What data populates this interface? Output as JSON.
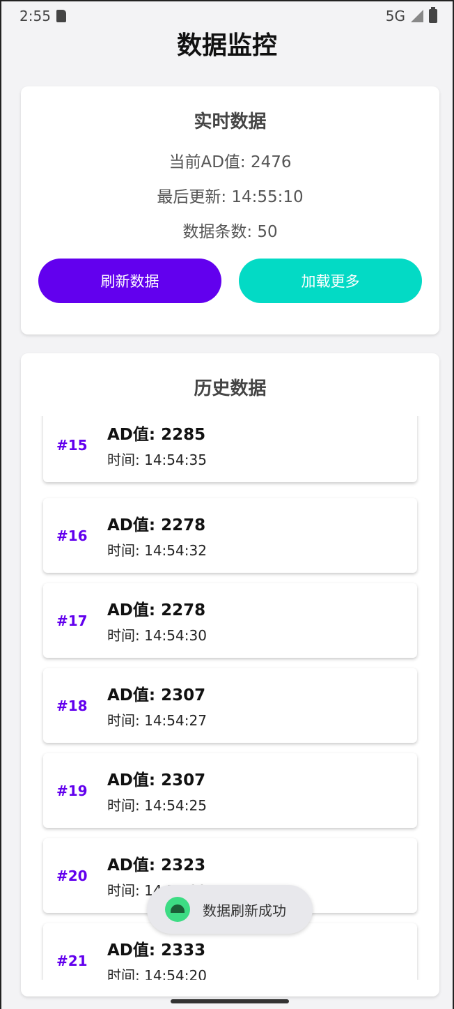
{
  "status_bar": {
    "time": "2:55",
    "network": "5G",
    "icons": [
      "sd-card-icon",
      "signal-icon",
      "battery-icon"
    ]
  },
  "page": {
    "title": "数据监控"
  },
  "realtime": {
    "title": "实时数据",
    "current_ad": "当前AD值: 2476",
    "last_update": "最后更新: 14:55:10",
    "count": "数据条数: 50",
    "refresh_label": "刷新数据",
    "load_more_label": "加载更多"
  },
  "history": {
    "title": "历史数据",
    "items": [
      {
        "index": "#15",
        "value": "AD值: 2285",
        "time": "时间: 14:54:35"
      },
      {
        "index": "#16",
        "value": "AD值: 2278",
        "time": "时间: 14:54:32"
      },
      {
        "index": "#17",
        "value": "AD值: 2278",
        "time": "时间: 14:54:30"
      },
      {
        "index": "#18",
        "value": "AD值: 2307",
        "time": "时间: 14:54:27"
      },
      {
        "index": "#19",
        "value": "AD值: 2307",
        "time": "时间: 14:54:25"
      },
      {
        "index": "#20",
        "value": "AD值: 2323",
        "time": "时间: 14:54:22"
      },
      {
        "index": "#21",
        "value": "AD值: 2333",
        "time": "时间: 14:54:20"
      }
    ]
  },
  "toast": {
    "text": "数据刷新成功",
    "icon": "android-icon"
  },
  "colors": {
    "primary": "#6200ee",
    "secondary": "#03dac5"
  }
}
